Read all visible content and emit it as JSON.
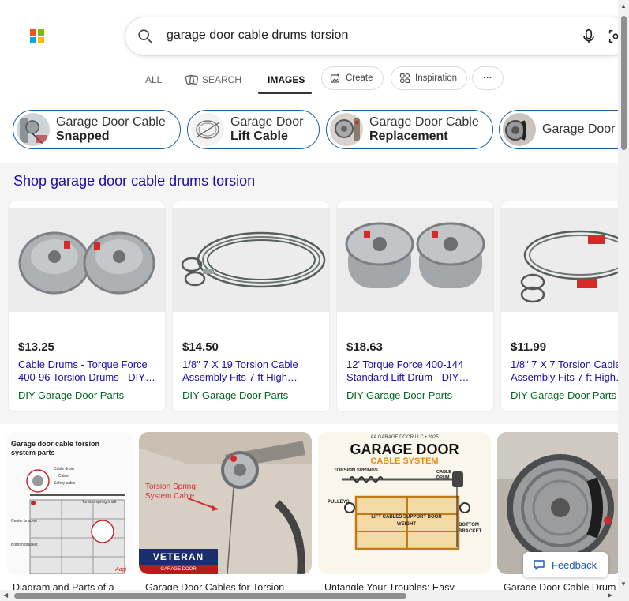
{
  "search": {
    "query": "garage door cable drums torsion"
  },
  "tabs": {
    "all": "ALL",
    "search": "SEARCH",
    "images": "IMAGES",
    "create": "Create",
    "inspiration": "Inspiration",
    "more": "···"
  },
  "related": [
    {
      "line1": "Garage Door Cable",
      "line2": "Snapped"
    },
    {
      "line1": "Garage Door",
      "line2": "Lift Cable"
    },
    {
      "line1": "Garage Door Cable",
      "line2": "Replacement"
    },
    {
      "line1": "Garage Door",
      "line2": ""
    }
  ],
  "shop": {
    "title": "Shop garage door cable drums torsion",
    "items": [
      {
        "price": "$13.25",
        "title1": "Cable Drums - Torque Force",
        "title2": "400-96 Torsion Drums - DIY…",
        "seller": "DIY Garage Door Parts"
      },
      {
        "price": "$14.50",
        "title1": "1/8\" 7 X 19 Torsion Cable",
        "title2": "Assembly Fits 7 ft High…",
        "seller": "DIY Garage Door Parts"
      },
      {
        "price": "$18.63",
        "title1": "12' Torque Force 400-144",
        "title2": "Standard Lift Drum - DIY…",
        "seller": "DIY Garage Door Parts"
      },
      {
        "price": "$11.99",
        "title1": "1/8\" 7 X 7 Torsion Cable",
        "title2": "Assembly Fits 7 ft High…",
        "seller": "DIY Garage Door Parts"
      }
    ]
  },
  "results": [
    {
      "caption": "Diagram and Parts of a",
      "img_title": "Garage door cable torsion system parts",
      "labels": [
        "Cable drum",
        "Cable",
        "Safety cable",
        "Torsion spring shaft",
        "Center bracket",
        "Bottom bracket"
      ]
    },
    {
      "caption": "Garage Door Cables for Torsion",
      "overlay1": "Torsion Spring",
      "overlay2": "System Cable",
      "brand": "VETERAN",
      "brand_sub": "GARAGE DOOR"
    },
    {
      "caption": "Untangle Your Troubles: Easy",
      "top_line": "AA GARAGE DOOR LLC • 2025",
      "heading": "GARAGE DOOR",
      "subheading": "CABLE SYSTEM",
      "label_springs": "TORSION SPRINGS",
      "label_drum": "CABLE DRUM",
      "label_pulleys": "PULLEYS",
      "label_lift": "LIFT CABLES SUPPORT DOOR WEIGHT",
      "label_bracket": "BOTTOM BRACKET"
    },
    {
      "caption": "Garage Door Cable Drum"
    }
  ],
  "feedback": "Feedback",
  "colors": {
    "link": "#1a0dab",
    "seller": "#006621",
    "chip_border": "#1b5e9e"
  }
}
